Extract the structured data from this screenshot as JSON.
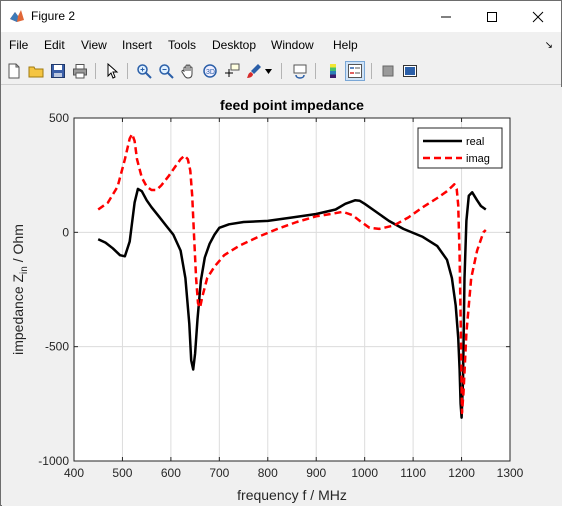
{
  "window": {
    "title": "Figure 2",
    "minimize_icon": "minimize-icon",
    "maximize_icon": "maximize-icon",
    "close_icon": "close-icon"
  },
  "menu": {
    "items": [
      "File",
      "Edit",
      "View",
      "Insert",
      "Tools",
      "Desktop",
      "Window",
      "Help"
    ]
  },
  "toolbar": {
    "icons": [
      "new-figure-icon",
      "open-file-icon",
      "save-icon",
      "print-icon",
      "pointer-icon",
      "zoom-in-icon",
      "zoom-out-icon",
      "pan-icon",
      "rotate-3d-icon",
      "data-cursor-icon",
      "brush-icon",
      "link-plot-icon",
      "colorbar-icon",
      "legend-icon",
      "hide-plot-tools-icon",
      "show-plot-tools-icon"
    ]
  },
  "colors": {
    "real": "#000000",
    "imag": "#ff0000",
    "grid": "#dcdcdc",
    "axes_bg": "#ffffff",
    "figure_bg": "#f0f0f0"
  },
  "chart_data": {
    "type": "line",
    "title": "feed point impedance",
    "xlabel": "frequency f / MHz",
    "ylabel_main": "impedance Z",
    "ylabel_sub": "in",
    "ylabel_unit": "  / Ohm",
    "xlim": [
      400,
      1300
    ],
    "ylim": [
      -1000,
      500
    ],
    "xticks": [
      400,
      500,
      600,
      700,
      800,
      900,
      1000,
      1100,
      1200,
      1300
    ],
    "yticks": [
      -1000,
      -500,
      0,
      500
    ],
    "xtick_labels": [
      "400",
      "500",
      "600",
      "700",
      "800",
      "900",
      "1000",
      "1100",
      "1200",
      "1300"
    ],
    "ytick_labels": [
      "-1000",
      "-500",
      "0",
      "500"
    ],
    "grid": true,
    "legend_position": "top-right",
    "series": [
      {
        "name": "real",
        "style": "solid",
        "x": [
          450,
          465,
          480,
          495,
          505,
          515,
          525,
          532,
          540,
          550,
          560,
          575,
          590,
          605,
          620,
          630,
          638,
          642,
          646,
          650,
          655,
          662,
          670,
          680,
          690,
          700,
          720,
          750,
          800,
          850,
          900,
          940,
          960,
          980,
          990,
          1000,
          1020,
          1050,
          1080,
          1120,
          1150,
          1170,
          1180,
          1188,
          1193,
          1196,
          1198,
          1200,
          1203,
          1206,
          1210,
          1215,
          1222,
          1232,
          1240,
          1250
        ],
        "y": [
          -30,
          -45,
          -70,
          -100,
          -105,
          -40,
          130,
          190,
          180,
          140,
          110,
          70,
          30,
          -10,
          -80,
          -200,
          -400,
          -560,
          -600,
          -530,
          -380,
          -210,
          -110,
          -50,
          -10,
          20,
          35,
          45,
          50,
          65,
          80,
          100,
          125,
          140,
          138,
          125,
          95,
          50,
          15,
          -20,
          -60,
          -120,
          -200,
          -320,
          -460,
          -600,
          -750,
          -810,
          -650,
          -200,
          50,
          160,
          175,
          140,
          115,
          100
        ]
      },
      {
        "name": "imag",
        "style": "dashed",
        "x": [
          450,
          470,
          490,
          505,
          515,
          520,
          525,
          530,
          540,
          550,
          560,
          570,
          580,
          595,
          610,
          620,
          628,
          635,
          640,
          644,
          648,
          652,
          656,
          660,
          665,
          675,
          690,
          710,
          740,
          780,
          820,
          860,
          900,
          930,
          955,
          975,
          990,
          1010,
          1030,
          1060,
          1090,
          1120,
          1150,
          1170,
          1180,
          1185,
          1190,
          1193,
          1196,
          1199,
          1201,
          1204,
          1210,
          1220,
          1232,
          1245,
          1250
        ],
        "y": [
          100,
          130,
          200,
          320,
          410,
          430,
          400,
          320,
          240,
          200,
          185,
          185,
          205,
          245,
          290,
          320,
          335,
          320,
          270,
          160,
          -20,
          -200,
          -310,
          -330,
          -280,
          -200,
          -150,
          -100,
          -60,
          -20,
          15,
          45,
          70,
          80,
          90,
          75,
          50,
          20,
          15,
          30,
          65,
          110,
          150,
          180,
          200,
          210,
          190,
          120,
          -100,
          -500,
          -790,
          -700,
          -440,
          -200,
          -80,
          0,
          10
        ]
      }
    ]
  }
}
